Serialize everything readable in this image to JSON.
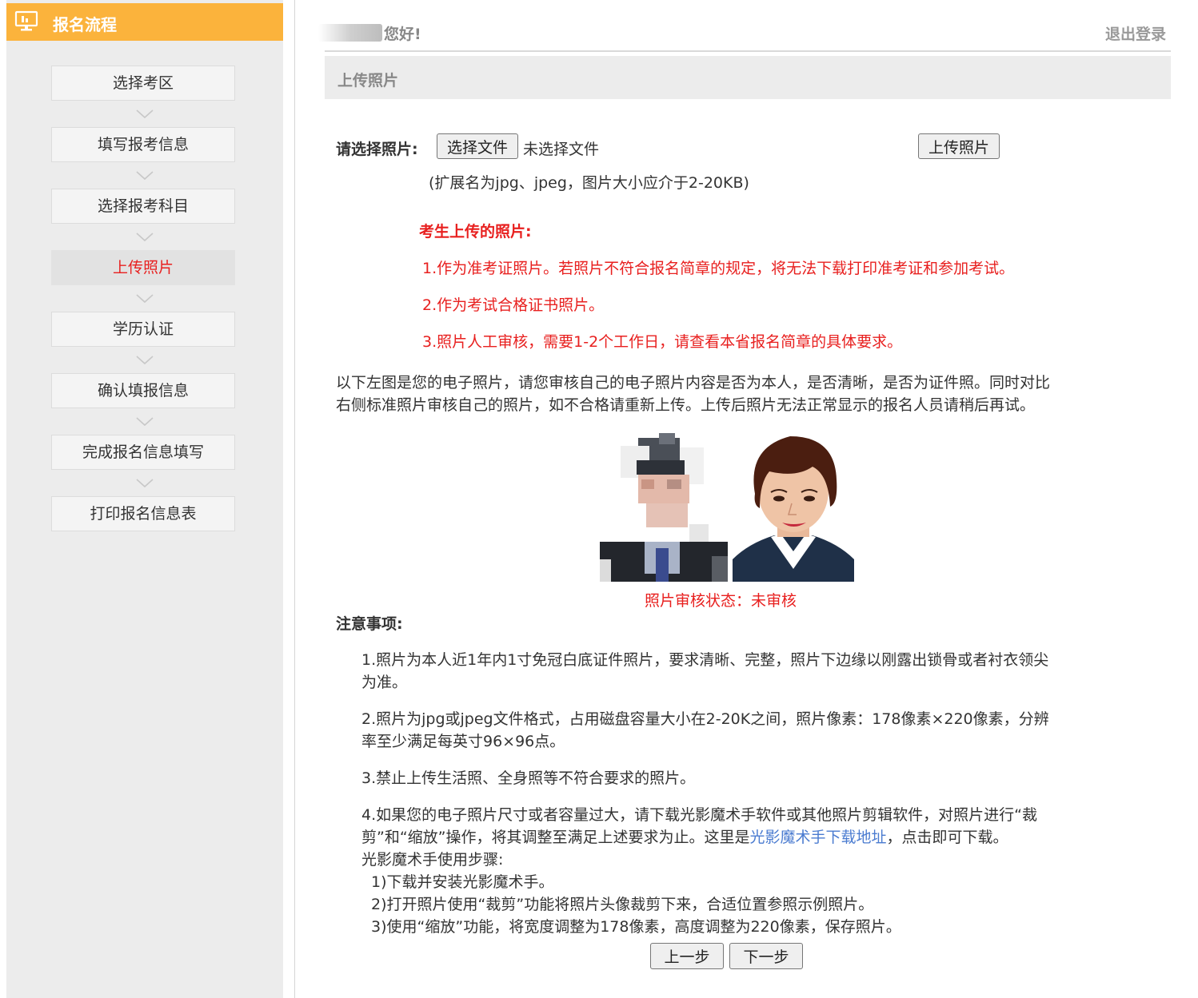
{
  "sidebar": {
    "title": "报名流程",
    "steps": [
      "选择考区",
      "填写报考信息",
      "选择报考科目",
      "上传照片",
      "学历认证",
      "确认填报信息",
      "完成报名信息填写",
      "打印报名信息表"
    ],
    "active_step": "上传照片"
  },
  "header": {
    "greeting": "您好!",
    "logout": "退出登录",
    "section_title": "上传照片"
  },
  "upload": {
    "label": "请选择照片:",
    "choose_button": "选择文件",
    "no_file_text": "未选择文件",
    "upload_button": "上传照片",
    "hint": "(扩展名为jpg、jpeg，图片大小应介于2-20KB)"
  },
  "candidate_notes": {
    "title": "考生上传的照片:",
    "items": [
      "1.作为准考证照片。若照片不符合报名简章的规定，将无法下载打印准考证和参加考试。",
      "2.作为考试合格证书照片。",
      "3.照片人工审核，需要1-2个工作日，请查看本省报名简章的具体要求。"
    ]
  },
  "compare_text": [
    "以下左图是您的电子照片，请您审核自己的电子照片内容是否为本人，是否清晰，是否为证件照。同时对比",
    "右侧标准照片审核自己的照片，如不合格请重新上传。上传后照片无法正常显示的报名人员请稍后再试。"
  ],
  "photo_status": "照片审核状态：未审核",
  "notice": {
    "title": "注意事项:",
    "item1": [
      "1.照片为本人近1年内1寸免冠白底证件照片，要求清晰、完整，照片下边缘以刚露出锁骨或者衬衣领尖",
      "为准。"
    ],
    "item2": [
      "2.照片为jpg或jpeg文件格式，占用磁盘容量大小在2-20K之间，照片像素：178像素×220像素，分辨",
      "率至少满足每英寸96×96点。"
    ],
    "item3": "3.禁止上传生活照、全身照等不符合要求的照片。",
    "item4_line1": "4.如果您的电子照片尺寸或者容量过大，请下载光影魔术手软件或其他照片剪辑软件，对照片进行“裁",
    "item4_line2_pre": "剪”和“缩放”操作，将其调整至满足上述要求为止。这里是",
    "item4_link": "光影魔术手下载地址",
    "item4_line2_post": "，点击即可下载。",
    "steps_title": "光影魔术手使用步骤:",
    "steps": [
      "1)下载并安装光影魔术手。",
      "2)打开照片使用“裁剪”功能将照片头像裁剪下来，合适位置参照示例照片。",
      "3)使用“缩放”功能，将宽度调整为178像素，高度调整为220像素，保存照片。"
    ]
  },
  "nav": {
    "prev": "上一步",
    "next": "下一步"
  },
  "colors": {
    "sidebar_header": "#fbb33c",
    "active_text": "#e8201f",
    "link": "#4a7bd0"
  }
}
